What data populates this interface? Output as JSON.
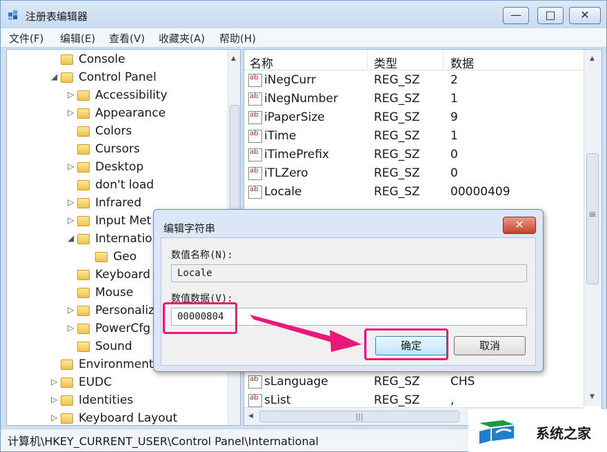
{
  "window": {
    "title": "注册表编辑器",
    "minimize": "—",
    "maximize": "□",
    "close": "✕"
  },
  "menu": [
    "文件(F)",
    "编辑(E)",
    "查看(V)",
    "收藏夹(A)",
    "帮助(H)"
  ],
  "tree": {
    "items": [
      {
        "label": "Console",
        "expander": ""
      },
      {
        "label": "Control Panel",
        "expander": "◢"
      },
      {
        "label": "Accessibility",
        "expander": "▷"
      },
      {
        "label": "Appearance",
        "expander": "▷"
      },
      {
        "label": "Colors",
        "expander": ""
      },
      {
        "label": "Cursors",
        "expander": ""
      },
      {
        "label": "Desktop",
        "expander": "▷"
      },
      {
        "label": "don't load",
        "expander": ""
      },
      {
        "label": "Infrared",
        "expander": "▷"
      },
      {
        "label": "Input Met",
        "expander": "▷"
      },
      {
        "label": "Internation",
        "expander": "◢"
      },
      {
        "label": "Geo",
        "expander": ""
      },
      {
        "label": "Keyboard",
        "expander": ""
      },
      {
        "label": "Mouse",
        "expander": ""
      },
      {
        "label": "Personaliz",
        "expander": "▷"
      },
      {
        "label": "PowerCfg",
        "expander": "▷"
      },
      {
        "label": "Sound",
        "expander": ""
      },
      {
        "label": "Environment",
        "expander": ""
      },
      {
        "label": "EUDC",
        "expander": "▷"
      },
      {
        "label": "Identities",
        "expander": "▷"
      },
      {
        "label": "Keyboard Layout",
        "expander": "▷"
      }
    ]
  },
  "list": {
    "columns": [
      "名称",
      "类型",
      "数据"
    ],
    "rows": [
      {
        "name": "iNegCurr",
        "type": "REG_SZ",
        "data": "2"
      },
      {
        "name": "iNegNumber",
        "type": "REG_SZ",
        "data": "1"
      },
      {
        "name": "iPaperSize",
        "type": "REG_SZ",
        "data": "9"
      },
      {
        "name": "iTime",
        "type": "REG_SZ",
        "data": "1"
      },
      {
        "name": "iTimePrefix",
        "type": "REG_SZ",
        "data": "0"
      },
      {
        "name": "iTLZero",
        "type": "REG_SZ",
        "data": "0"
      },
      {
        "name": "Locale",
        "type": "REG_SZ",
        "data": "00000409"
      },
      {
        "name": "sLanguage",
        "type": "REG_SZ",
        "data": "CHS"
      },
      {
        "name": "sList",
        "type": "REG_SZ",
        "data": ","
      }
    ],
    "icon_text": "ab"
  },
  "dialog": {
    "title": "编辑字符串",
    "name_label": "数值名称(N):",
    "name_value": "Locale",
    "data_label": "数值数据(V):",
    "data_value": "00000804",
    "ok": "确定",
    "cancel": "取消",
    "close": "✕"
  },
  "status": {
    "path": "计算机\\HKEY_CURRENT_USER\\Control Panel\\International"
  },
  "watermark": {
    "text": "系统之家"
  },
  "colors": {
    "highlight": "#e8197a",
    "folder": "#eec24a"
  }
}
